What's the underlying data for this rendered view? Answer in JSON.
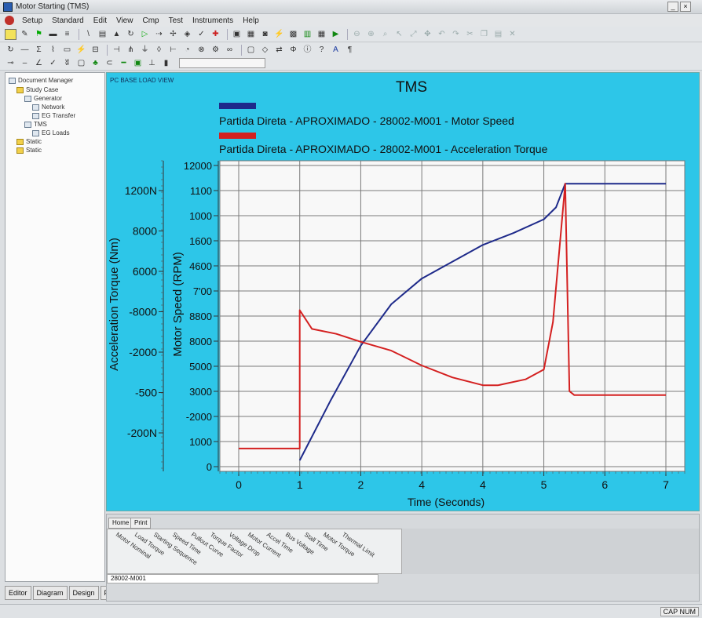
{
  "window": {
    "title": "Motor Starting (TMS)"
  },
  "chart_data": {
    "type": "line",
    "title": "TMS",
    "panel_label": "PC BASE LOAD VIEW",
    "xlabel": "Time (Seconds)",
    "ylabel_left": "Acceleration Torque (Nm)",
    "ylabel_right": "Motor Speed (RPM)",
    "xlim": [
      0,
      7
    ],
    "xticks": [
      "0",
      "1",
      "2",
      "4",
      "4",
      "5",
      "6",
      "7"
    ],
    "left_ticks": [
      "1200N",
      "8000",
      "6000",
      "-8000",
      "-2000",
      "-500",
      "-200N"
    ],
    "right_ticks": [
      "12000",
      "1100",
      "1000",
      "1600",
      "4600",
      "7'00",
      "8800",
      "8000",
      "5000",
      "3000",
      "-2000",
      "1000",
      "0"
    ],
    "legend_position": "top-left",
    "grid": true,
    "series": [
      {
        "name": "Partida Direta - APROXIMADO - 28002-M001 - Motor Speed",
        "color": "#1e2a8a",
        "axis": "right",
        "x": [
          1.0,
          1.5,
          2.0,
          2.5,
          3.0,
          3.5,
          4.0,
          4.5,
          5.0,
          5.2,
          5.35,
          6.0,
          7.0
        ],
        "y": [
          0,
          300,
          580,
          790,
          920,
          1005,
          1090,
          1150,
          1220,
          1280,
          1400,
          1400,
          1400
        ]
      },
      {
        "name": "Partida Direta - APROXIMADO - 28002-M001 - Acceleration Torque",
        "color": "#d42020",
        "axis": "right",
        "x": [
          0,
          1.0,
          1.0,
          1.2,
          1.6,
          2.0,
          2.5,
          3.0,
          3.5,
          4.0,
          4.25,
          4.7,
          5.0,
          5.15,
          5.35,
          5.42,
          5.5,
          6.0,
          7.0
        ],
        "y": [
          60,
          60,
          760,
          665,
          640,
          600,
          555,
          480,
          420,
          380,
          380,
          410,
          460,
          700,
          1400,
          350,
          330,
          330,
          330
        ]
      }
    ]
  },
  "bottom_panel": {
    "tabs": [
      "Home",
      "Print"
    ],
    "columns": [
      "Motor Nominal",
      "Load Torque",
      "Starting Sequence",
      "Speed Time",
      "Pullout Curve",
      "Torque Factor",
      "Voltage Drop",
      "Motor Current",
      "Accel Time",
      "Bus Voltage",
      "Stall Time",
      "Motor Torque",
      "Thermal Limit"
    ],
    "row_text": "28002-M001"
  },
  "tree": {
    "items": [
      "Document Manager",
      "Study Case",
      "Generator",
      "Network",
      "EG Transfer",
      "TMS",
      "EG Loads",
      "Static",
      "Static"
    ],
    "tabs": [
      "Editor",
      "Diagram",
      "Design",
      "Plot"
    ]
  },
  "menus": [
    "Setup",
    "Standard",
    "Edit",
    "View",
    "Cmp",
    "Test",
    "Instruments",
    "Help"
  ],
  "status": {
    "right": "CAP NUM"
  }
}
